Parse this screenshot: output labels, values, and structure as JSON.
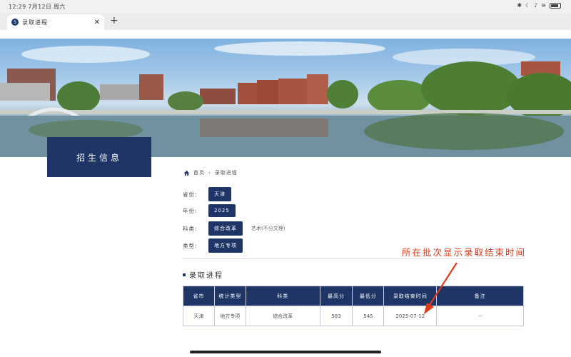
{
  "status_bar": {
    "time": "12:29  7月12日  周六"
  },
  "browser": {
    "tab_title": "录取进程",
    "favicon_text": "S",
    "close_glyph": "✕",
    "newtab_glyph": "+"
  },
  "sidebar": {
    "title": "招生信息"
  },
  "breadcrumb": {
    "home": "首页",
    "separator": "›",
    "current": "录取进程"
  },
  "filters": {
    "province": {
      "label": "省份:",
      "value": "天津"
    },
    "year": {
      "label": "年份:",
      "value": "2025"
    },
    "category": {
      "label": "科类:",
      "value": "综合改革",
      "other": "艺术(不分文理)"
    },
    "type": {
      "label": "类型:",
      "value": "地方专项"
    }
  },
  "section": {
    "title": "录取进程"
  },
  "table": {
    "headers": [
      "省市",
      "统计类型",
      "科类",
      "最高分",
      "最低分",
      "录取结束时间",
      "备注"
    ],
    "rows": [
      [
        "天津",
        "地方专项",
        "综合改革",
        "583",
        "545",
        "2025-07-12",
        "--"
      ]
    ]
  },
  "annotation": {
    "text": "所在批次显示录取结束时间",
    "color": "#e03a1a"
  },
  "colors": {
    "primary": "#1e3566",
    "annotation": "#e03a1a"
  },
  "icons": {
    "home": "home-icon",
    "close": "close-icon",
    "battery": "battery-icon"
  }
}
